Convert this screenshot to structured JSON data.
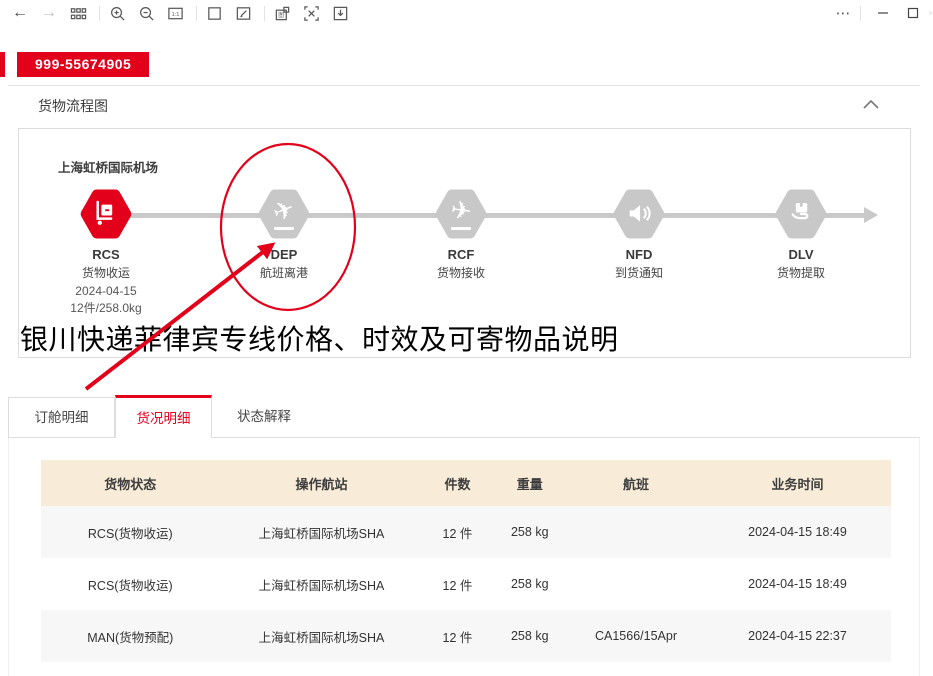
{
  "toolbar": {
    "icons": [
      {
        "name": "back-icon"
      },
      {
        "name": "forward-icon",
        "disabled": true
      },
      {
        "name": "grid-icon"
      },
      {
        "name": "divider"
      },
      {
        "name": "zoom-in-icon"
      },
      {
        "name": "zoom-out-icon"
      },
      {
        "name": "ratio-1-1-icon"
      },
      {
        "name": "divider"
      },
      {
        "name": "fit-page-icon"
      },
      {
        "name": "edit-icon"
      },
      {
        "name": "divider"
      },
      {
        "name": "copy-image-icon"
      },
      {
        "name": "extract-text-icon"
      },
      {
        "name": "save-download-icon"
      }
    ],
    "window_controls": [
      {
        "name": "more-icon"
      },
      {
        "name": "divider"
      },
      {
        "name": "minimize-icon"
      },
      {
        "name": "maximize-icon"
      },
      {
        "name": "close-icon",
        "partial": true
      }
    ]
  },
  "awb": {
    "number": "999-55674905"
  },
  "section": {
    "title": "货物流程图",
    "collapse_icon": "chevron-up-icon"
  },
  "flow": {
    "origin_airport": "上海虹桥国际机场",
    "nodes": [
      {
        "code": "RCS",
        "name": "货物收运",
        "date": "2024-04-15",
        "pieces": "12件/258.0kg",
        "icon": "trolley-icon",
        "state": "active"
      },
      {
        "code": "DEP",
        "name": "航班离港",
        "icon": "plane-takeoff-icon",
        "state": "pending"
      },
      {
        "code": "RCF",
        "name": "货物接收",
        "icon": "plane-landing-icon",
        "state": "pending"
      },
      {
        "code": "NFD",
        "name": "到货通知",
        "icon": "speaker-icon",
        "state": "pending"
      },
      {
        "code": "DLV",
        "name": "货物提取",
        "icon": "hand-box-icon",
        "state": "pending"
      }
    ],
    "annotation": {
      "shape": "red-ellipse-with-arrow",
      "highlights": "DEP",
      "color": "#e2001a"
    }
  },
  "headline": {
    "text": "银川快递菲律宾专线价格、时效及可寄物品说明"
  },
  "tabs": [
    {
      "label": "订舱明细",
      "active": false
    },
    {
      "label": "货况明细",
      "active": true
    },
    {
      "label": "状态解释",
      "active": false
    }
  ],
  "table": {
    "headers": [
      "货物状态",
      "操作航站",
      "件数",
      "重量",
      "航班",
      "业务时间"
    ],
    "rows": [
      [
        "RCS(货物收运)",
        "上海虹桥国际机场SHA",
        "12 件",
        "258 kg",
        "",
        "2024-04-15 18:49"
      ],
      [
        "RCS(货物收运)",
        "上海虹桥国际机场SHA",
        "12 件",
        "258 kg",
        "",
        "2024-04-15 18:49"
      ],
      [
        "MAN(货物预配)",
        "上海虹桥国际机场SHA",
        "12 件",
        "258 kg",
        "CA1566/15Apr",
        "2024-04-15 22:37"
      ]
    ]
  },
  "colors": {
    "accent": "#e2001a",
    "node_gray": "#c8c8c8",
    "connector_gray": "#c9c9c9",
    "table_header_bg": "#f8ecd9",
    "alt_row_bg": "#f7f7f7"
  }
}
